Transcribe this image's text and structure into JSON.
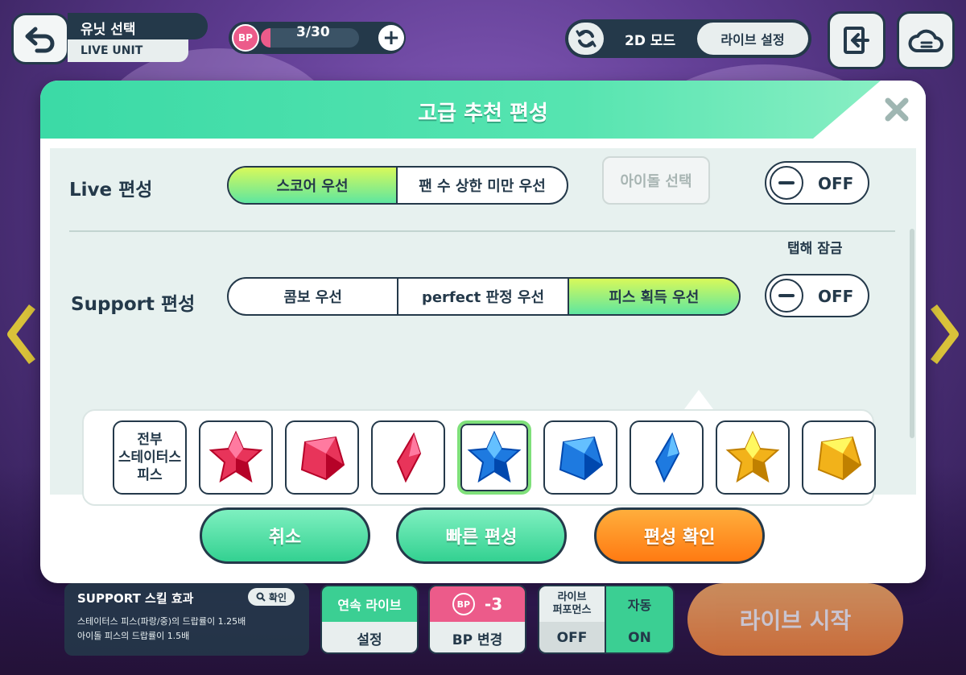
{
  "header": {
    "title_kr": "유닛 선택",
    "title_en": "LIVE UNIT",
    "bp_icon_label": "BP",
    "bp_value": "3/30",
    "bp_fraction": 0.1,
    "mode_label": "2D 모드",
    "live_settings_label": "라이브 설정"
  },
  "modal": {
    "title": "고급 추천 편성",
    "live_row": {
      "label": "Live 편성",
      "options": [
        "스코어 우선",
        "팬 수 상한 미만 우선"
      ],
      "selected_index": 0,
      "idol_select_label": "아이돌 선택",
      "toggle_label": "OFF"
    },
    "tap_lock_label": "탭해 잠금",
    "support_row": {
      "label": "Support 편성",
      "options": [
        "콤보 우선",
        "perfect 판정 우선",
        "피스 획득 우선"
      ],
      "selected_index": 2,
      "toggle_label": "OFF"
    },
    "pieces": {
      "all_label": [
        "전부",
        "스테이터스",
        "피스"
      ],
      "items": [
        {
          "icon": "red-star-piece-icon",
          "color": "#e8345a"
        },
        {
          "icon": "red-cube-piece-icon",
          "color": "#e8345a"
        },
        {
          "icon": "red-shard-piece-icon",
          "color": "#e8345a"
        },
        {
          "icon": "blue-star-piece-icon",
          "color": "#1e7ae0",
          "selected": true
        },
        {
          "icon": "blue-cube-piece-icon",
          "color": "#1e7ae0"
        },
        {
          "icon": "blue-shard-piece-icon",
          "color": "#1e7ae0"
        },
        {
          "icon": "yellow-star-piece-icon",
          "color": "#f2b21a"
        },
        {
          "icon": "yellow-cube-piece-icon",
          "color": "#f2b21a"
        }
      ]
    },
    "buttons": {
      "cancel": "취소",
      "quick": "빠른 편성",
      "confirm": "편성 확인"
    }
  },
  "bottom": {
    "support_title": "SUPPORT 스킬 효과",
    "support_confirm": "확인",
    "support_lines": [
      "스테이터스 피스(파랑/중)의 드랍률이 1.25배",
      "아이돌 피스의 드랍률이 1.5배"
    ],
    "continuous_live": {
      "top": "연속 라이브",
      "bottom": "설정"
    },
    "bp_change": {
      "icon": "BP",
      "value": "-3",
      "bottom": "BP 변경"
    },
    "live_performance": {
      "top_line1": "라이브",
      "top_line2": "퍼포먼스",
      "bottom": "OFF"
    },
    "auto": {
      "top": "자동",
      "bottom": "ON"
    },
    "live_start": "라이브 시작"
  },
  "colors": {
    "navy": "#24394a",
    "mint": "#3bdaa6",
    "orange": "#ff7a12",
    "pink": "#ec5b8a"
  }
}
